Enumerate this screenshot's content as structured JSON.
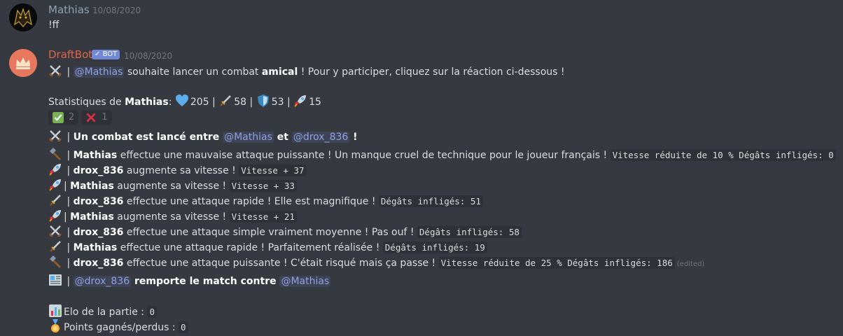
{
  "msg1": {
    "author": "Mathias",
    "timestamp": "10/08/2020",
    "text": "!ff"
  },
  "msg2": {
    "author": "DraftBot",
    "bot_badge": "BOT",
    "timestamp": "10/08/2020",
    "intro": {
      "sep": " | ",
      "mention": "@Mathias",
      "pre": " souhaite lancer un combat ",
      "bold": "amical",
      "post": " ! Pour y participer, cliquez sur la réaction ci-dessous !"
    },
    "stats": {
      "label": "Statistiques de ",
      "name": "Mathias",
      "colon": ":",
      "health": "205",
      "attack": "58",
      "defense": "53",
      "speed": "15",
      "sep": " | "
    },
    "reactions": [
      {
        "icon": "check-icon",
        "count": "2"
      },
      {
        "icon": "cross-icon",
        "count": "1"
      }
    ],
    "combat_start": {
      "sep": " | ",
      "text": "Un combat est lancé entre ",
      "m1": "@Mathias",
      "and": " et ",
      "m2": "@drox_836",
      "end": " !"
    },
    "log": [
      {
        "icon": "hammer-icon",
        "actor": "Mathias",
        "text": " effectue une mauvaise attaque puissante ! Un manque cruel de technique pour le joueur français ! ",
        "code": "Vitesse réduite de 10 % Dégâts infligés: 0"
      },
      {
        "icon": "rocket-icon",
        "actor": "drox_836",
        "text": " augmente sa vitesse ! ",
        "code": "Vitesse + 37"
      },
      {
        "icon": "rocket-icon",
        "actor": "Mathias",
        "text": " augmente sa vitesse ! ",
        "code": "Vitesse + 33"
      },
      {
        "icon": "dagger-icon",
        "actor": "drox_836",
        "text": " effectue une attaque rapide ! Elle est magnifique ! ",
        "code": "Dégâts infligés: 51"
      },
      {
        "icon": "rocket-icon",
        "actor": "Mathias",
        "text": " augmente sa vitesse ! ",
        "code": "Vitesse + 21"
      },
      {
        "icon": "crossed-swords-icon",
        "actor": "drox_836",
        "text": " effectue une attaque simple vraiment moyenne ! Pas ouf ! ",
        "code": "Dégâts infligés: 58"
      },
      {
        "icon": "dagger-icon",
        "actor": "Mathias",
        "text": " effectue une attaque rapide ! Parfaitement réalisée ! ",
        "code": "Dégâts infligés: 19"
      },
      {
        "icon": "hammer-icon",
        "actor": "drox_836",
        "text": " effectue une attaque puissante ! C'était risqué mais ça passe ! ",
        "code": "Vitesse réduite de 25 % Dégâts infligés: 186",
        "edited": "(edited)"
      }
    ],
    "winner": {
      "sep": " | ",
      "mention": "@drox_836",
      "text": " remporte le match contre ",
      "loser": "@Mathias"
    },
    "elo": {
      "label": "Elo de la partie : ",
      "value": "0"
    },
    "points": {
      "label": "Points gagnés/perdus : ",
      "value": "0"
    }
  },
  "colors": {
    "background": "#36393f",
    "mathias_name": "#8ea2b6",
    "draftbot_name": "#e0664a",
    "mention": "#8ea1e1",
    "bot_badge": "#7289da"
  }
}
